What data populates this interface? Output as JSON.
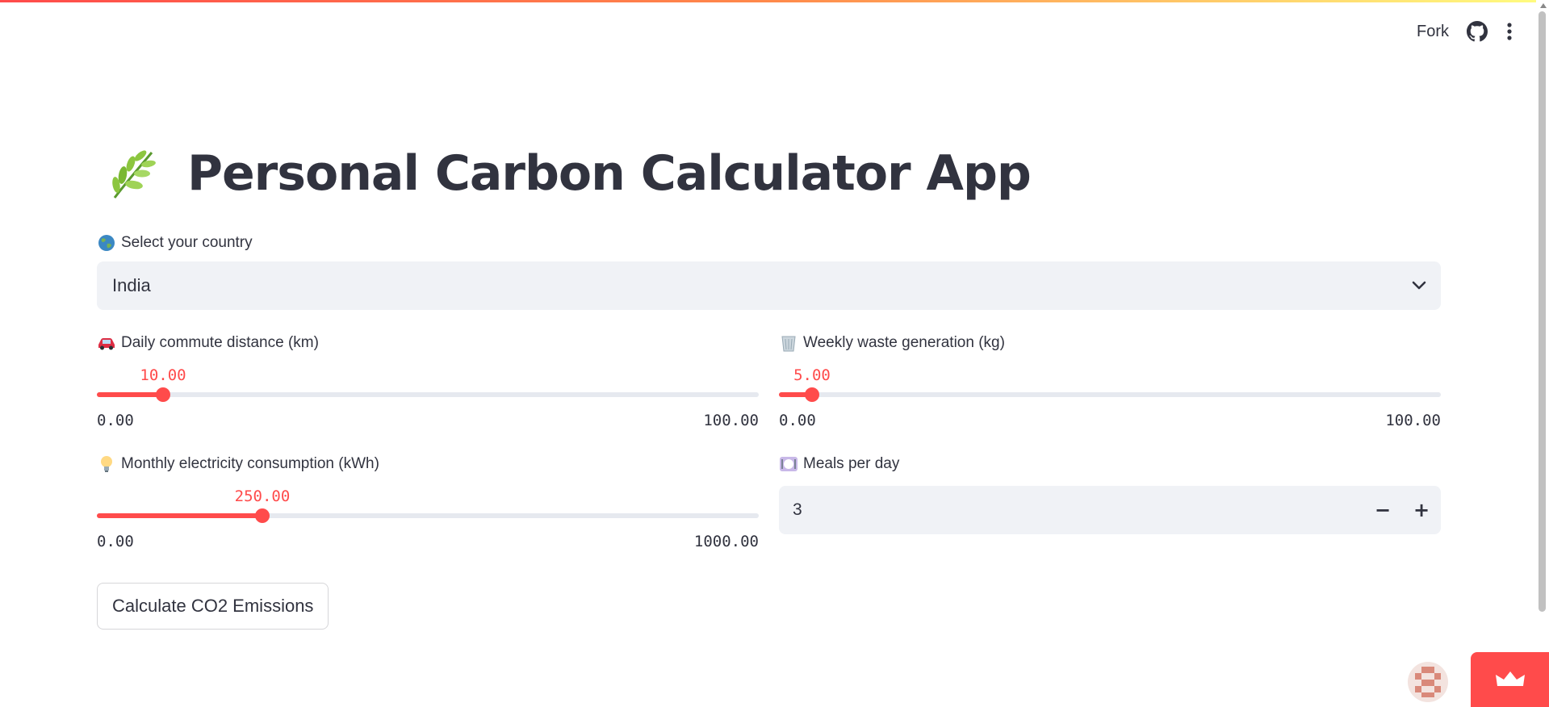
{
  "header": {
    "fork_label": "Fork",
    "github_icon": "github-icon",
    "menu_icon": "more-vertical-icon",
    "accent_stripe": [
      "#ff4b4b",
      "#fffd80"
    ]
  },
  "main": {
    "title_emoji": "herb-icon",
    "title": "Personal Carbon Calculator App",
    "country": {
      "label_emoji": "globe-icon",
      "label": "Select your country",
      "selected_value": "India"
    },
    "commute": {
      "label_emoji": "car-icon",
      "label": "Daily commute distance (km)",
      "value": "10.00",
      "value_num": 10,
      "min": "0.00",
      "max": "100.00",
      "min_num": 0,
      "max_num": 100
    },
    "waste": {
      "label_emoji": "wastebasket-icon",
      "label": "Weekly waste generation (kg)",
      "value": "5.00",
      "value_num": 5,
      "min": "0.00",
      "max": "100.00",
      "min_num": 0,
      "max_num": 100
    },
    "electricity": {
      "label_emoji": "light-bulb-icon",
      "label": "Monthly electricity consumption (kWh)",
      "value": "250.00",
      "value_num": 250,
      "min": "0.00",
      "max": "1000.00",
      "min_num": 0,
      "max_num": 1000
    },
    "meals": {
      "label_emoji": "plate-icon",
      "label": "Meals per day",
      "value": "3",
      "decrement": "−",
      "increment": "+"
    },
    "calculate_button": "Calculate CO2 Emissions"
  },
  "colors": {
    "accent": "#ff4b4b",
    "text": "#31333f",
    "input_bg": "#f0f2f6",
    "track": "#e6e9ef"
  }
}
